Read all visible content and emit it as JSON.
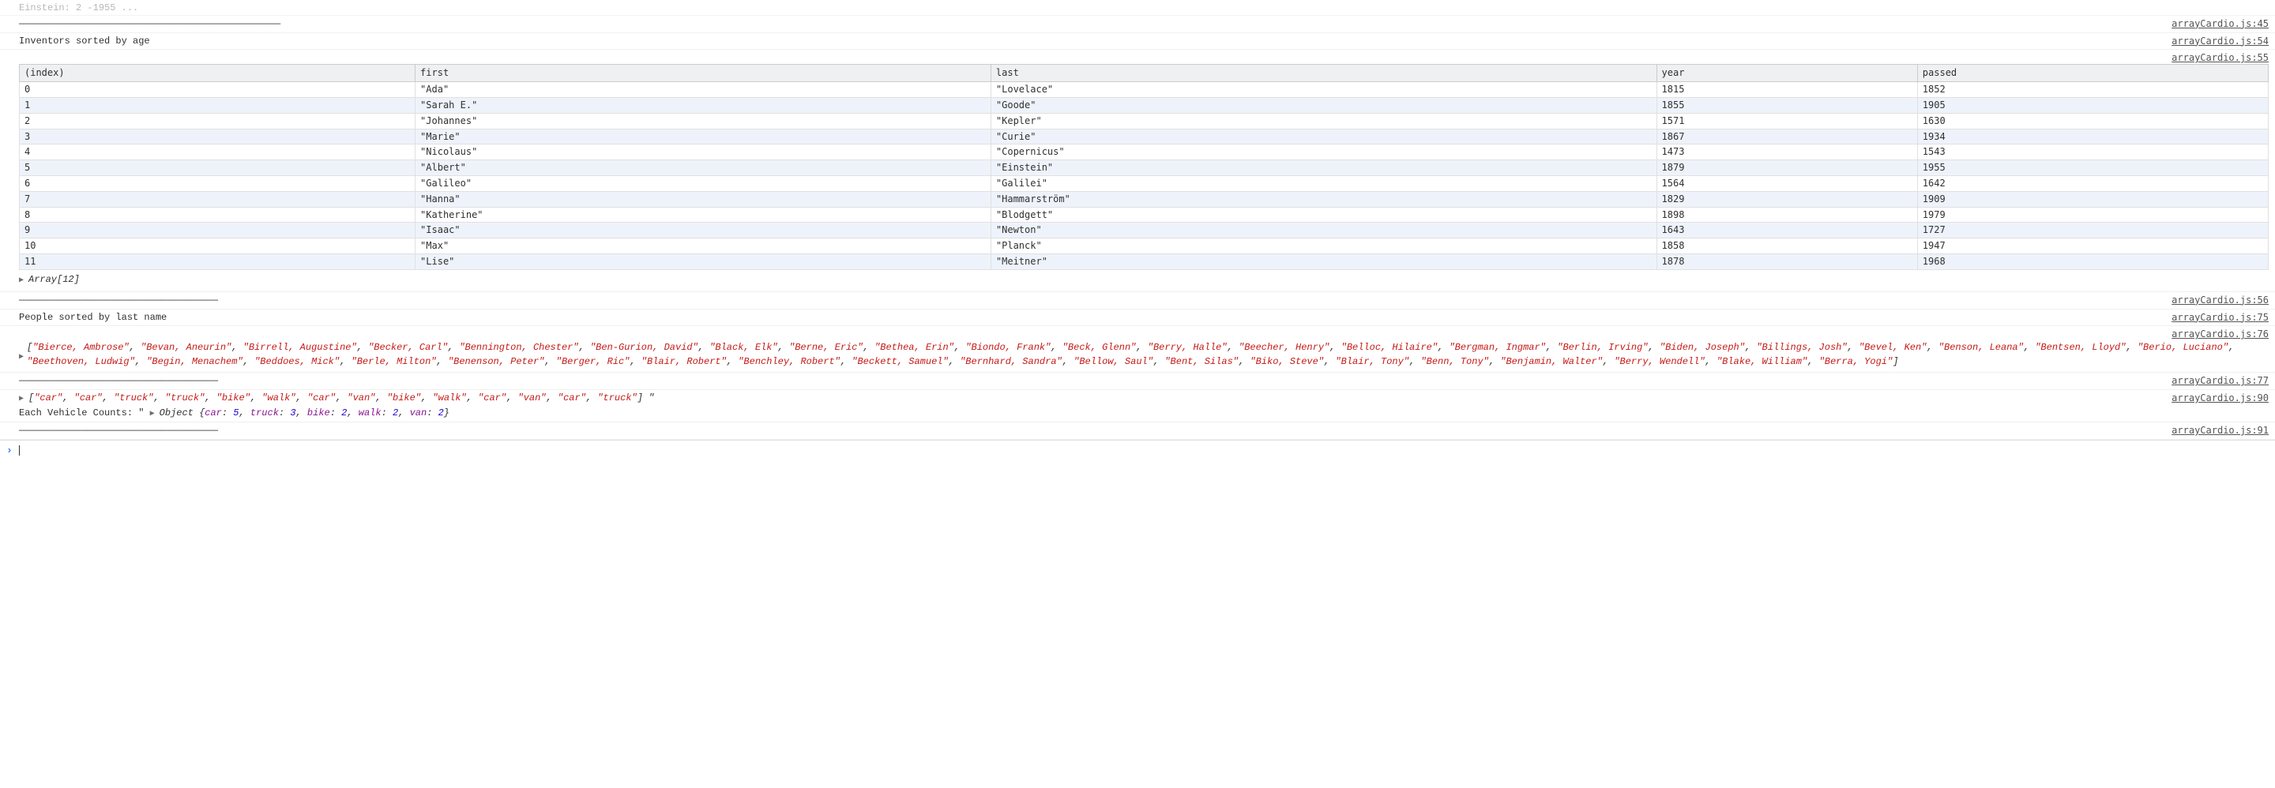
{
  "source_file": "arrayCardio.js",
  "top_faded_line": "Einstein: 2 -1955 ...",
  "separator": "——————————————————————————————————————————————",
  "dash_line": "———————————————————————————————————",
  "links": {
    "l45": "arrayCardio.js:45",
    "l54": "arrayCardio.js:54",
    "l55": "arrayCardio.js:55",
    "l56": "arrayCardio.js:56",
    "l75": "arrayCardio.js:75",
    "l76": "arrayCardio.js:76",
    "l77": "arrayCardio.js:77",
    "l90": "arrayCardio.js:90",
    "l91": "arrayCardio.js:91"
  },
  "log1": "Inventors sorted by age",
  "table": {
    "columns": [
      "(index)",
      "first",
      "last",
      "year",
      "passed"
    ],
    "rows": [
      {
        "index": "0",
        "first": "\"Ada\"",
        "last": "\"Lovelace\"",
        "year": "1815",
        "passed": "1852"
      },
      {
        "index": "1",
        "first": "\"Sarah E.\"",
        "last": "\"Goode\"",
        "year": "1855",
        "passed": "1905"
      },
      {
        "index": "2",
        "first": "\"Johannes\"",
        "last": "\"Kepler\"",
        "year": "1571",
        "passed": "1630"
      },
      {
        "index": "3",
        "first": "\"Marie\"",
        "last": "\"Curie\"",
        "year": "1867",
        "passed": "1934"
      },
      {
        "index": "4",
        "first": "\"Nicolaus\"",
        "last": "\"Copernicus\"",
        "year": "1473",
        "passed": "1543"
      },
      {
        "index": "5",
        "first": "\"Albert\"",
        "last": "\"Einstein\"",
        "year": "1879",
        "passed": "1955"
      },
      {
        "index": "6",
        "first": "\"Galileo\"",
        "last": "\"Galilei\"",
        "year": "1564",
        "passed": "1642"
      },
      {
        "index": "7",
        "first": "\"Hanna\"",
        "last": "\"Hammarström\"",
        "year": "1829",
        "passed": "1909"
      },
      {
        "index": "8",
        "first": "\"Katherine\"",
        "last": "\"Blodgett\"",
        "year": "1898",
        "passed": "1979"
      },
      {
        "index": "9",
        "first": "\"Isaac\"",
        "last": "\"Newton\"",
        "year": "1643",
        "passed": "1727"
      },
      {
        "index": "10",
        "first": "\"Max\"",
        "last": "\"Planck\"",
        "year": "1858",
        "passed": "1947"
      },
      {
        "index": "11",
        "first": "\"Lise\"",
        "last": "\"Meitner\"",
        "year": "1878",
        "passed": "1968"
      }
    ]
  },
  "array_summary": "Array[12]",
  "log2": "People sorted by last name",
  "people": [
    "Bierce, Ambrose",
    "Bevan, Aneurin",
    "Birrell, Augustine",
    "Becker, Carl",
    "Bennington, Chester",
    "Ben-Gurion, David",
    "Black, Elk",
    "Berne, Eric",
    "Bethea, Erin",
    "Biondo, Frank",
    "Beck, Glenn",
    "Berry, Halle",
    "Beecher, Henry",
    "Belloc, Hilaire",
    "Bergman, Ingmar",
    "Berlin, Irving",
    "Biden, Joseph",
    "Billings, Josh",
    "Bevel, Ken",
    "Benson, Leana",
    "Bentsen, Lloyd",
    "Berio, Luciano",
    "Beethoven, Ludwig",
    "Begin, Menachem",
    "Beddoes, Mick",
    "Berle, Milton",
    "Benenson, Peter",
    "Berger, Ric",
    "Blair, Robert",
    "Benchley, Robert",
    "Beckett, Samuel",
    "Bernhard, Sandra",
    "Bellow, Saul",
    "Bent, Silas",
    "Biko, Steve",
    "Blair, Tony",
    "Benn, Tony",
    "Benjamin, Walter",
    "Berry, Wendell",
    "Blake, William",
    "Berra, Yogi"
  ],
  "vehicles": [
    "car",
    "car",
    "truck",
    "truck",
    "bike",
    "walk",
    "car",
    "van",
    "bike",
    "walk",
    "car",
    "van",
    "car",
    "truck"
  ],
  "vehicles_trailing": " \"",
  "vehicles_label": "Each Vehicle Counts: \"",
  "vehicle_counts": {
    "car": 5,
    "truck": 3,
    "bike": 2,
    "walk": 2,
    "van": 2
  }
}
